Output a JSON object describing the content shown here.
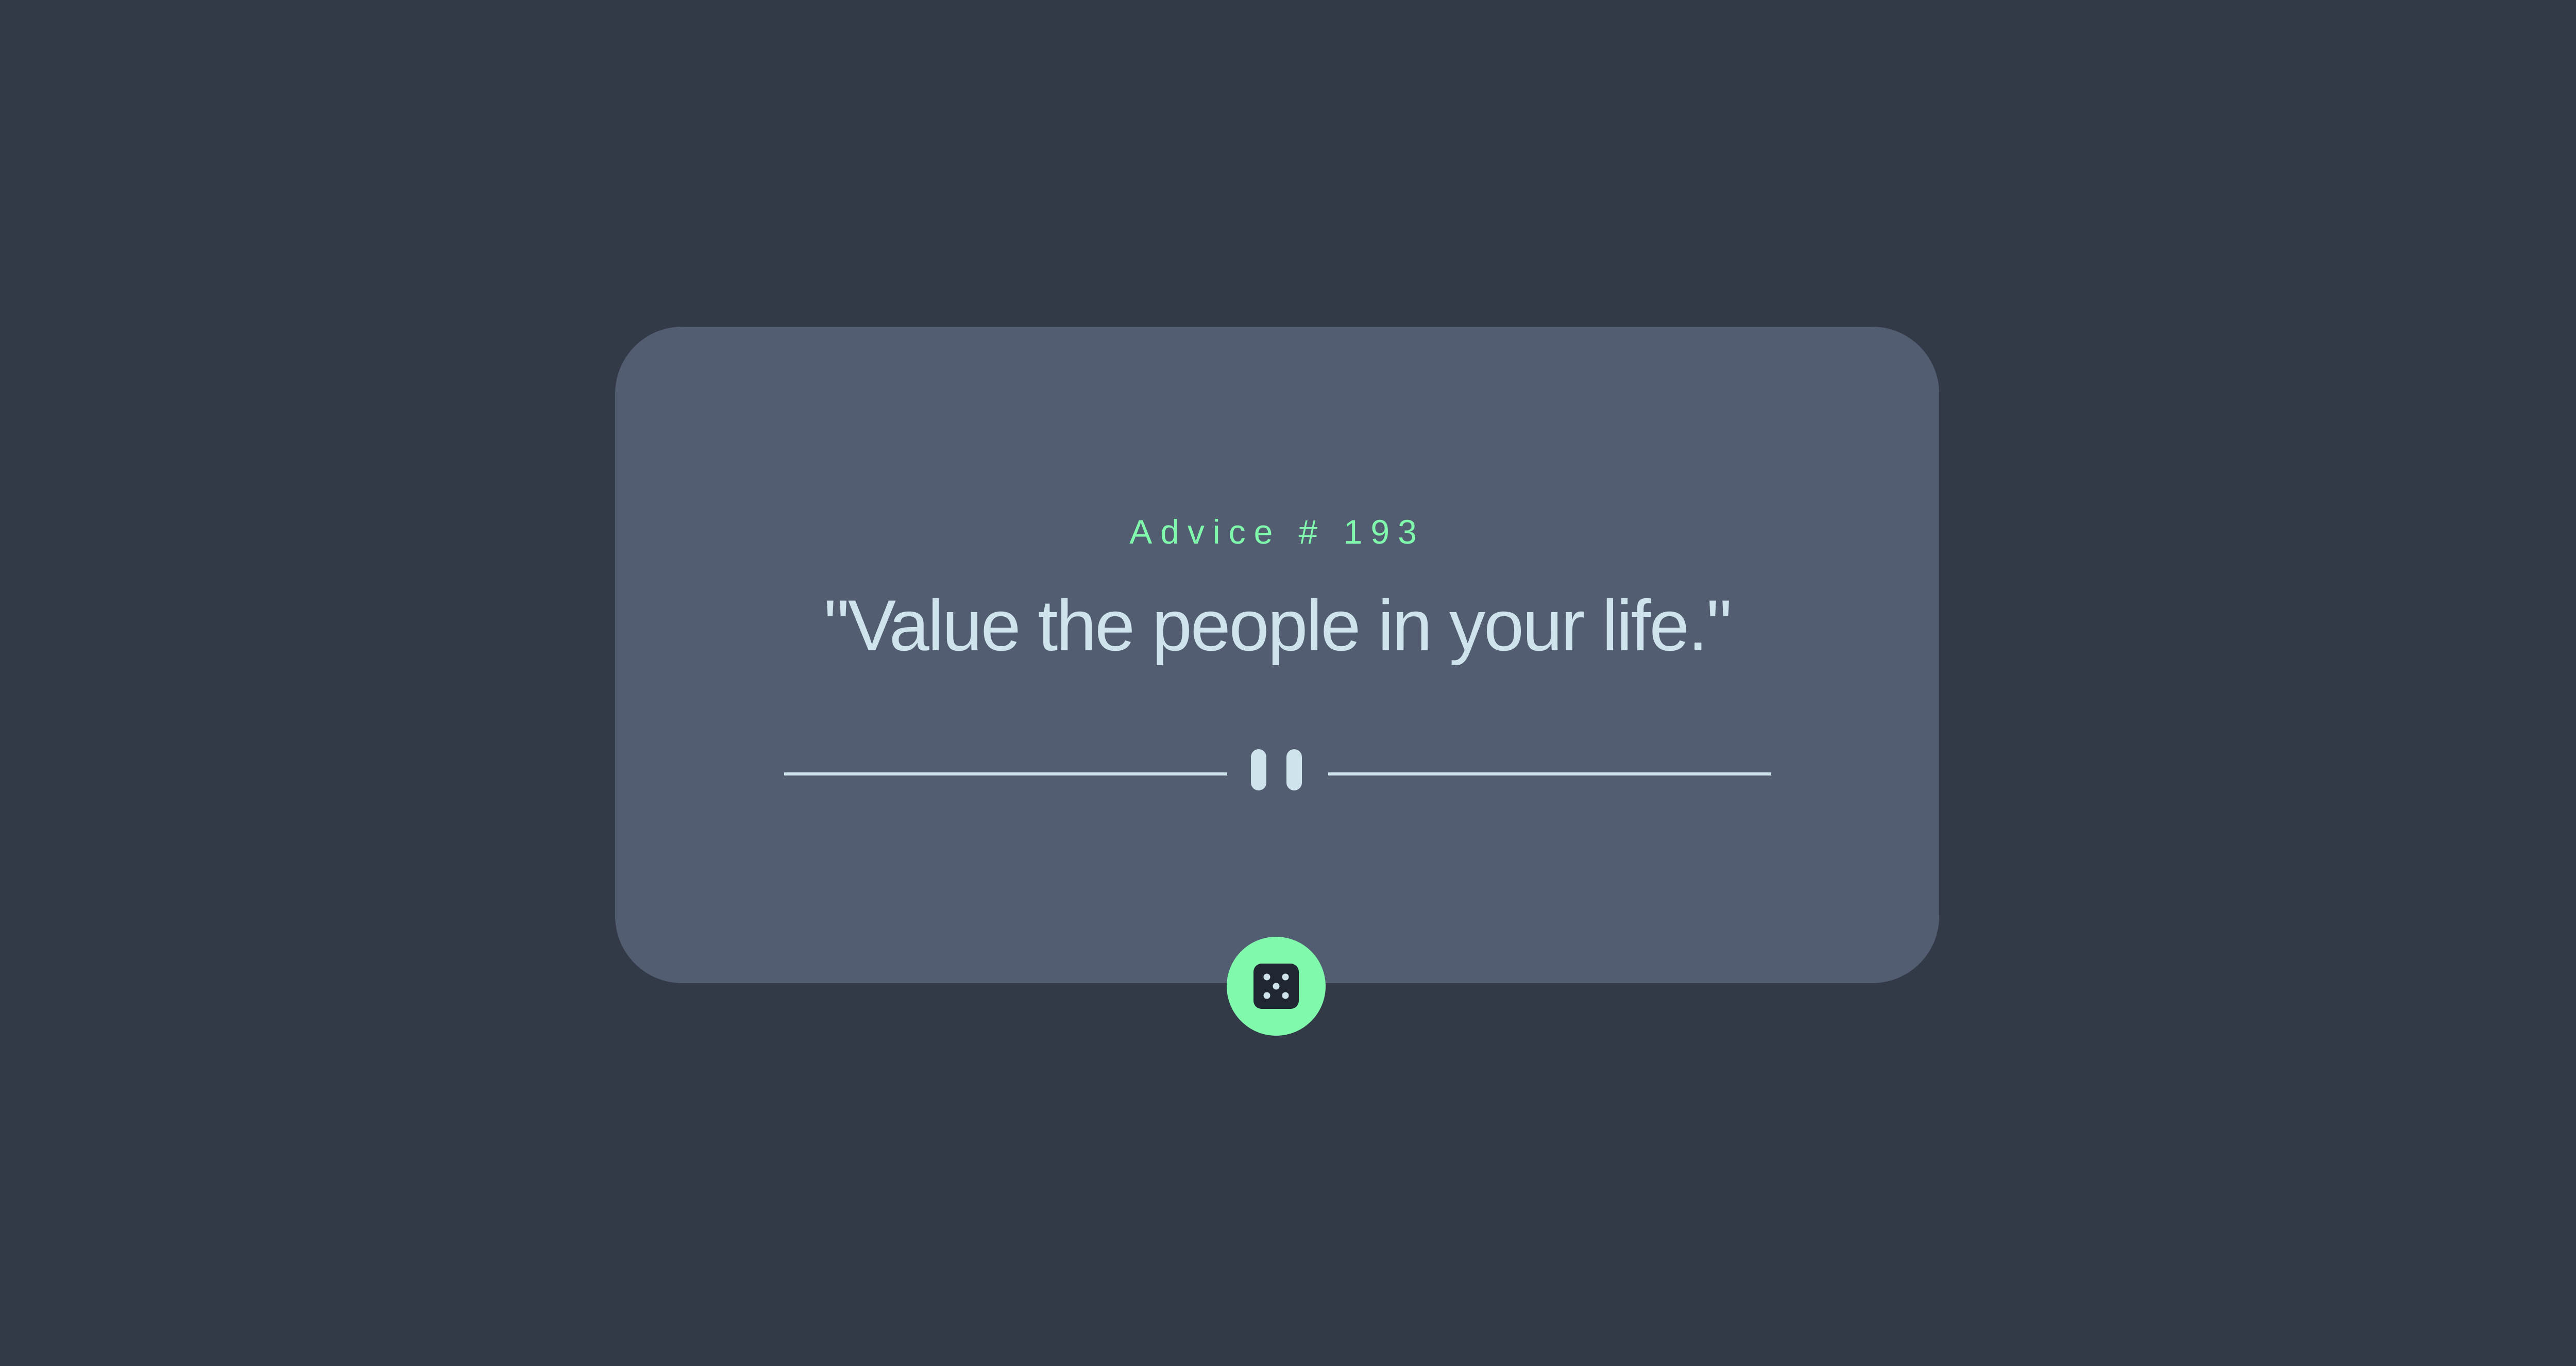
{
  "advice": {
    "label": "Advice # 193",
    "text": "\"Value the people in your life.\""
  },
  "divider": {
    "icon": "pause-icon"
  },
  "dice_button": {
    "icon": "dice-icon"
  },
  "colors": {
    "background": "#323947",
    "card": "#525D71",
    "accent": "#80F9AD",
    "text": "#CFE3EC",
    "dice_face": "#202733"
  }
}
